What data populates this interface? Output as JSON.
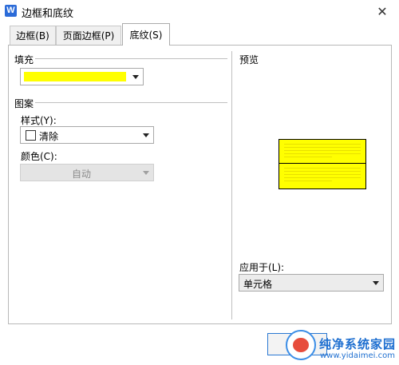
{
  "window": {
    "title": "边框和底纹",
    "app_icon_letter": "W"
  },
  "tabs": [
    {
      "label": "边框(B)",
      "active": false
    },
    {
      "label": "页面边框(P)",
      "active": false
    },
    {
      "label": "底纹(S)",
      "active": true
    }
  ],
  "fill": {
    "label": "填充",
    "color": "#ffff00"
  },
  "pattern": {
    "label": "图案",
    "style_label": "样式(Y):",
    "style_value": "清除",
    "color_label": "颜色(C):",
    "color_value": "自动"
  },
  "preview": {
    "label": "预览",
    "fill_color": "#ffff00"
  },
  "apply_to": {
    "label": "应用于(L):",
    "value": "单元格"
  },
  "watermark": {
    "brand": "纯净系统家园",
    "url": "www.yidaimei.com"
  }
}
